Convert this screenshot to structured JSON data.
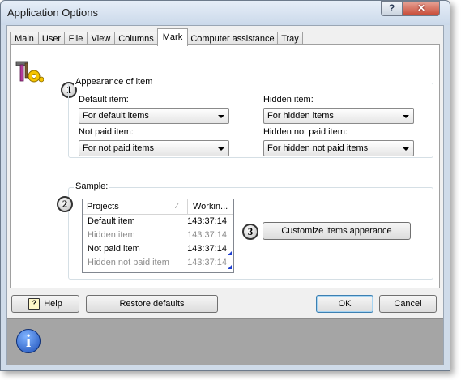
{
  "window": {
    "title": "Application Options",
    "help_glyph": "?",
    "close_glyph": "✕"
  },
  "tabs": [
    {
      "label": "Main"
    },
    {
      "label": "User"
    },
    {
      "label": "File"
    },
    {
      "label": "View"
    },
    {
      "label": "Columns"
    },
    {
      "label": "Mark"
    },
    {
      "label": "Computer assistance"
    },
    {
      "label": "Tray"
    }
  ],
  "active_tab": "Mark",
  "appearance": {
    "badge": "1",
    "group_label": "Appearance of item",
    "default_item": {
      "label": "Default item:",
      "value": "For default items"
    },
    "hidden_item": {
      "label": "Hidden item:",
      "value": "For hidden items"
    },
    "not_paid_item": {
      "label": "Not paid item:",
      "value": "For not paid items"
    },
    "hidden_not_paid_item": {
      "label": "Hidden not paid item:",
      "value": "For hidden not paid items"
    }
  },
  "sample": {
    "badge": "2",
    "group_label": "Sample:",
    "columns": [
      "Projects",
      "Workin..."
    ],
    "rows": [
      {
        "name": "Default item",
        "time": "143:37:14"
      },
      {
        "name": "Hidden item",
        "time": "143:37:14"
      },
      {
        "name": "Not paid item",
        "time": "143:37:14"
      },
      {
        "name": "Hidden not paid item",
        "time": "143:37:14"
      }
    ],
    "customize_badge": "3",
    "customize_button": "Customize items apperance"
  },
  "footer": {
    "help_icon_glyph": "?",
    "help": "Help",
    "restore_defaults": "Restore defaults",
    "ok": "OK",
    "cancel": "Cancel"
  },
  "info_icon_glyph": "i",
  "colors": {
    "gray_text": "#8c8c8c",
    "accent_blue": "#1e3fd0"
  }
}
